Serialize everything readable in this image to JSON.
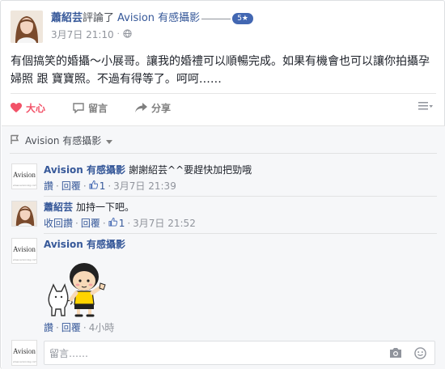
{
  "post": {
    "author": "蕭紹芸",
    "verb": "評論了",
    "page": "Avision 有感攝影",
    "rating": "5★",
    "date": "3月7日 21:10",
    "dot": "·",
    "text": "有個搞笑的婚攝～小展哥。讓我的婚禮可以順暢完成。如果有機會也可以讓你拍攝孕婦照 跟 寶寶照。不過有得等了。呵呵……"
  },
  "actions": {
    "like": "大心",
    "comment": "留言",
    "share": "分享"
  },
  "comments": {
    "page_name": "Avision 有感攝影",
    "brand_mark": "Avision",
    "brand_sub": "www.avisionzg.com",
    "items": [
      {
        "name": "Avision 有感攝影",
        "text": "謝謝紹芸^^要趕快加把勁哦",
        "like_link": "讚",
        "reply_link": "回覆",
        "like_count": "1",
        "time": "3月7日 21:39",
        "dot": "·"
      },
      {
        "name": "蕭紹芸",
        "text": "加持一下吧。",
        "like_link": "收回讚",
        "reply_link": "回覆",
        "like_count": "1",
        "time": "3月7日 21:52",
        "dot": "·"
      },
      {
        "name": "Avision 有感攝影",
        "text": "",
        "like_link": "讚",
        "reply_link": "回覆",
        "time": "4小時",
        "dot": "·"
      }
    ],
    "input_placeholder": "留言……"
  },
  "colors": {
    "link": "#365899",
    "love": "#f25268",
    "badge": "#4267b2",
    "muted": "#90949c",
    "comments_bg": "#f6f7f9"
  }
}
